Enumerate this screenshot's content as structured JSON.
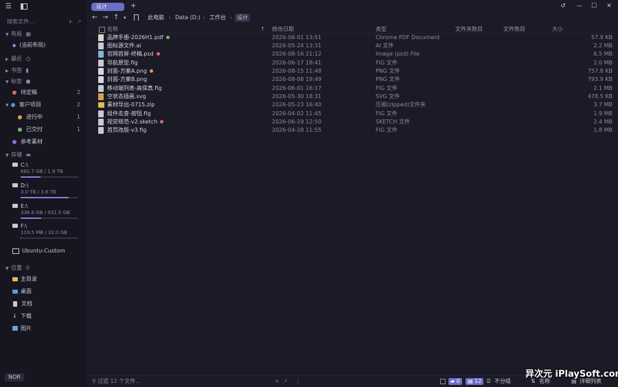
{
  "titlebar": {
    "active_tab": "设计",
    "new_tab": "+",
    "history_icon": "history-icon",
    "minimize": "—",
    "maximize": "☐",
    "close": "✕"
  },
  "sidebar": {
    "search_placeholder": "搜索文件...",
    "sections": {
      "layout": "布局",
      "layout_item": "(当前布局)",
      "recent": "最近",
      "bookmarks": "书签",
      "tags": "标签",
      "storage": "存储",
      "places": "位置"
    },
    "tags": [
      {
        "label": "待定稿",
        "count": "2",
        "color": "#d9686c"
      },
      {
        "label": "客户项目",
        "count": "2",
        "color": "#5b8fd6"
      },
      {
        "label": "进行中",
        "count": "1",
        "color": "#d6a24a"
      },
      {
        "label": "已交付",
        "count": "1",
        "color": "#7fb36b"
      },
      {
        "label": "参考素材",
        "count": "",
        "color": "#8a6fd0"
      }
    ],
    "drives": [
      {
        "name": "C:\\",
        "usage": "682.7 GB / 1.9 TB",
        "fill": 0.35
      },
      {
        "name": "D:\\",
        "usage": "3.0 TB / 3.6 TB",
        "fill": 0.83
      },
      {
        "name": "E:\\",
        "usage": "336.6 GB / 931.5 GB",
        "fill": 0.36
      },
      {
        "name": "F:\\",
        "usage": "119.5 MB / 32.0 GB",
        "fill": 0.01
      }
    ],
    "ubuntu": "Ubuntu-Custom",
    "places": [
      {
        "label": "主目录",
        "icon": "folder-icon"
      },
      {
        "label": "桌面",
        "icon": "desktop-icon"
      },
      {
        "label": "文档",
        "icon": "document-icon"
      },
      {
        "label": "下载",
        "icon": "download-icon"
      },
      {
        "label": "图片",
        "icon": "image-icon"
      }
    ],
    "mode": "NOR"
  },
  "toolbar": {
    "back": "←",
    "forward": "→",
    "up": "↑",
    "dropdown": "▾",
    "breadcrumb": [
      "此电脑",
      "Data (D:)",
      "工作台",
      "设计"
    ]
  },
  "table": {
    "headers": {
      "name": "名称",
      "sort": "↑",
      "date": "修改日期",
      "type": "类型",
      "folder_count": "文件夹数目",
      "file_count": "文件数目",
      "size": "大小"
    },
    "rows": [
      {
        "name": "品牌手册-2026H1.pdf",
        "date": "2026-06-01 13:51",
        "type": "Chrome PDF Document",
        "size": "57.9 KB",
        "icon": "pdf-icon",
        "tag": "#7fb36b"
      },
      {
        "name": "图标源文件.ai",
        "date": "2026-05-24 13:31",
        "type": "AI 文件",
        "size": "2.2 MB",
        "icon": "file-icon",
        "tag": ""
      },
      {
        "name": "官网首屏-终稿.psd",
        "date": "2026-08-16 21:12",
        "type": "Image (psd) File",
        "size": "6.5 MB",
        "icon": "psd-icon",
        "tag": "#d9686c"
      },
      {
        "name": "导航原型.fig",
        "date": "2026-06-17 18:41",
        "type": "FIG 文件",
        "size": "2.0 MB",
        "icon": "file-icon",
        "tag": ""
      },
      {
        "name": "封面-方案A.png",
        "date": "2026-08-15 11:48",
        "type": "PNG 文件",
        "size": "757.8 KB",
        "icon": "png-icon",
        "tag": "#d6a24a"
      },
      {
        "name": "封面-方案B.png",
        "date": "2026-08-08 19:49",
        "type": "PNG 文件",
        "size": "793.9 KB",
        "icon": "png-icon",
        "tag": ""
      },
      {
        "name": "移动端列表-高保真.fig",
        "date": "2026-06-01 16:17",
        "type": "FIG 文件",
        "size": "2.1 MB",
        "icon": "file-icon",
        "tag": ""
      },
      {
        "name": "空状态插画.svg",
        "date": "2026-05-30 18:31",
        "type": "SVG 文件",
        "size": "478.5 KB",
        "icon": "svg-icon",
        "tag": ""
      },
      {
        "name": "素材导出-0715.zip",
        "date": "2026-05-23 16:40",
        "type": "压缩(zipped)文件夹",
        "size": "3.7 MB",
        "icon": "zip-icon",
        "tag": ""
      },
      {
        "name": "组件走查-按钮.fig",
        "date": "2026-04-02 11:45",
        "type": "FIG 文件",
        "size": "1.9 MB",
        "icon": "file-icon",
        "tag": ""
      },
      {
        "name": "视觉规范-v2.sketch",
        "date": "2026-06-19 12:50",
        "type": "SKETCH 文件",
        "size": "2.4 MB",
        "icon": "file-icon",
        "tag": "#d9686c"
      },
      {
        "name": "首页改版-v3.fig",
        "date": "2026-04-28 11:55",
        "type": "FIG 文件",
        "size": "1.8 MB",
        "icon": "file-icon",
        "tag": ""
      }
    ]
  },
  "statusbar": {
    "filter_placeholder": "过滤 12 个文件...",
    "folders": "0",
    "files": "12",
    "group": "不分组",
    "sort": "名称",
    "view": "详细列表"
  },
  "watermark": "异次元 iPlaySoft.com",
  "colors": {
    "accent": "#6b6fc6",
    "background": "#1b1a27",
    "sidebar": "#161520"
  }
}
